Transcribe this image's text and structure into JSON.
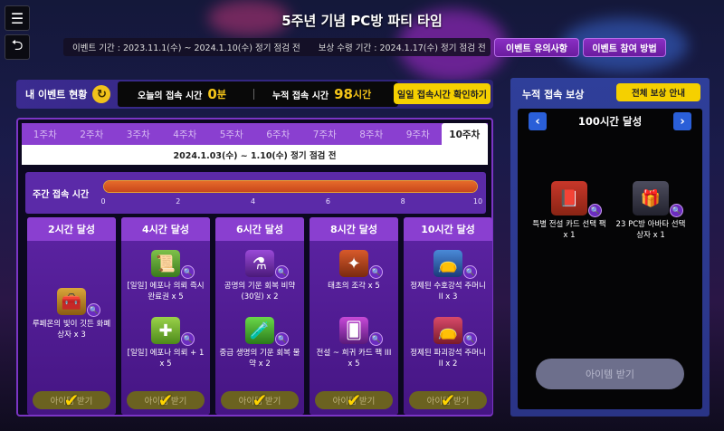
{
  "header": {
    "title": "5주년 기념 PC방 파티 타임",
    "event_period": "이벤트 기간 : 2023.11.1(수) ~ 2024.1.10(수) 정기 점검 전",
    "reward_period": "보상 수령 기간 : 2024.1.17(수) 정기 점검 전",
    "notes_button": "이벤트 유의사항",
    "howto_button": "이벤트 참여 방법"
  },
  "side": {
    "menu_icon": "hamburger-icon",
    "back_icon": "back-arrow-icon"
  },
  "status": {
    "label": "내 이벤트 현황",
    "today_label": "오늘의 접속 시간",
    "today_value": "0",
    "today_unit": "분",
    "total_label": "누적 접속 시간",
    "total_value": "98",
    "total_unit": "시간",
    "confirm_button": "일일 접속시간 확인하기"
  },
  "tabs": [
    "1주차",
    "2주차",
    "3주차",
    "4주차",
    "5주차",
    "6주차",
    "7주차",
    "8주차",
    "9주차",
    "10주차"
  ],
  "active_tab": 9,
  "week_period": "2024.1.03(수) ~ 1.10(수) 정기 점검 전",
  "weekly": {
    "label": "주간 접속 시간",
    "ticks": [
      "0",
      "2",
      "4",
      "6",
      "8",
      "10"
    ],
    "progress": 1.0
  },
  "rewards": [
    {
      "title": "2시간 달성",
      "items": [
        {
          "icon": "treasure-chest-icon",
          "name": "루페온의 빛이 깃든 화폐 상자 x 3"
        }
      ],
      "claim": "아이템 받기"
    },
    {
      "title": "4시간 달성",
      "items": [
        {
          "icon": "scroll-icon",
          "name": "[일일] 에포나 의뢰 즉시 완료권 x 5"
        },
        {
          "icon": "epona-plus-icon",
          "name": "[일일] 에포나 의뢰 + 1 x 5"
        }
      ],
      "claim": "아이템 받기"
    },
    {
      "title": "6시간 달성",
      "items": [
        {
          "icon": "purple-potion-icon",
          "name": "공명의 기운 회복 비약 (30일) x 2"
        },
        {
          "icon": "green-potion-icon",
          "name": "중급 생명의 기운 회복 물약 x 2"
        }
      ],
      "claim": "아이템 받기"
    },
    {
      "title": "8시간 달성",
      "items": [
        {
          "icon": "engraving-piece-icon",
          "name": "태초의 조각 x 5"
        },
        {
          "icon": "card-pack-icon",
          "name": "전설 ~ 희귀 카드 팩 III x 5"
        }
      ],
      "claim": "아이템 받기"
    },
    {
      "title": "10시간 달성",
      "items": [
        {
          "icon": "blue-stone-pouch-icon",
          "name": "정제된 수호강석 주머니 II x 3"
        },
        {
          "icon": "red-stone-pouch-icon",
          "name": "정제된 파괴강석 주머니 II x 2"
        }
      ],
      "claim": "아이템 받기"
    }
  ],
  "cumulative": {
    "title": "누적 접속 보상",
    "guide_button": "전체 보상 안내",
    "milestone": "100시간 달성",
    "items": [
      {
        "icon": "legendary-card-book-icon",
        "name": "특별 전설 카드 선택 팩 x 1"
      },
      {
        "icon": "avatar-box-icon",
        "name": "23 PC방 아바타 선택 상자 x 1"
      }
    ],
    "receive_button": "아이템 받기"
  },
  "colors": {
    "accent_yellow": "#f5d000",
    "purple": "#8a3fd0",
    "bar_orange": "#e66a2a"
  }
}
